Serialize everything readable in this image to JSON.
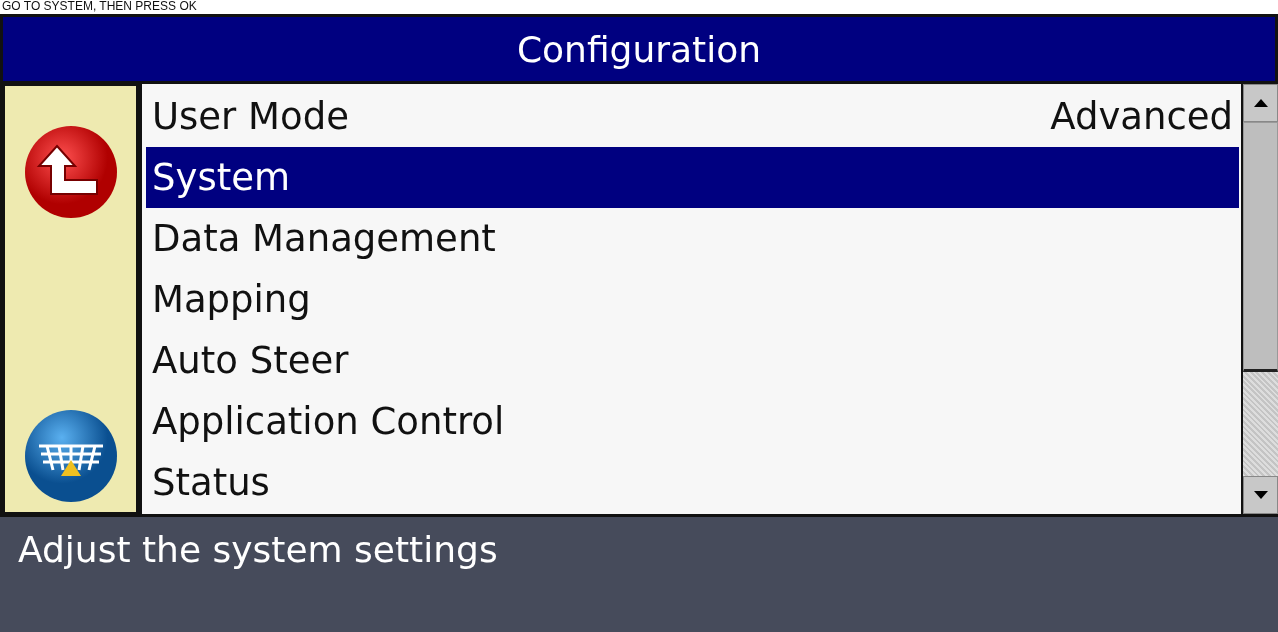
{
  "caption": "GO TO SYSTEM, THEN PRESS OK",
  "window": {
    "title": "Configuration"
  },
  "menu": {
    "items": [
      {
        "label": "User Mode",
        "value": "Advanced",
        "selected": false
      },
      {
        "label": "System",
        "selected": true
      },
      {
        "label": "Data Management",
        "selected": false
      },
      {
        "label": "Mapping",
        "selected": false
      },
      {
        "label": "Auto Steer",
        "selected": false
      },
      {
        "label": "Application Control",
        "selected": false
      },
      {
        "label": "Status",
        "selected": false
      }
    ]
  },
  "help_text": "Adjust the system settings"
}
